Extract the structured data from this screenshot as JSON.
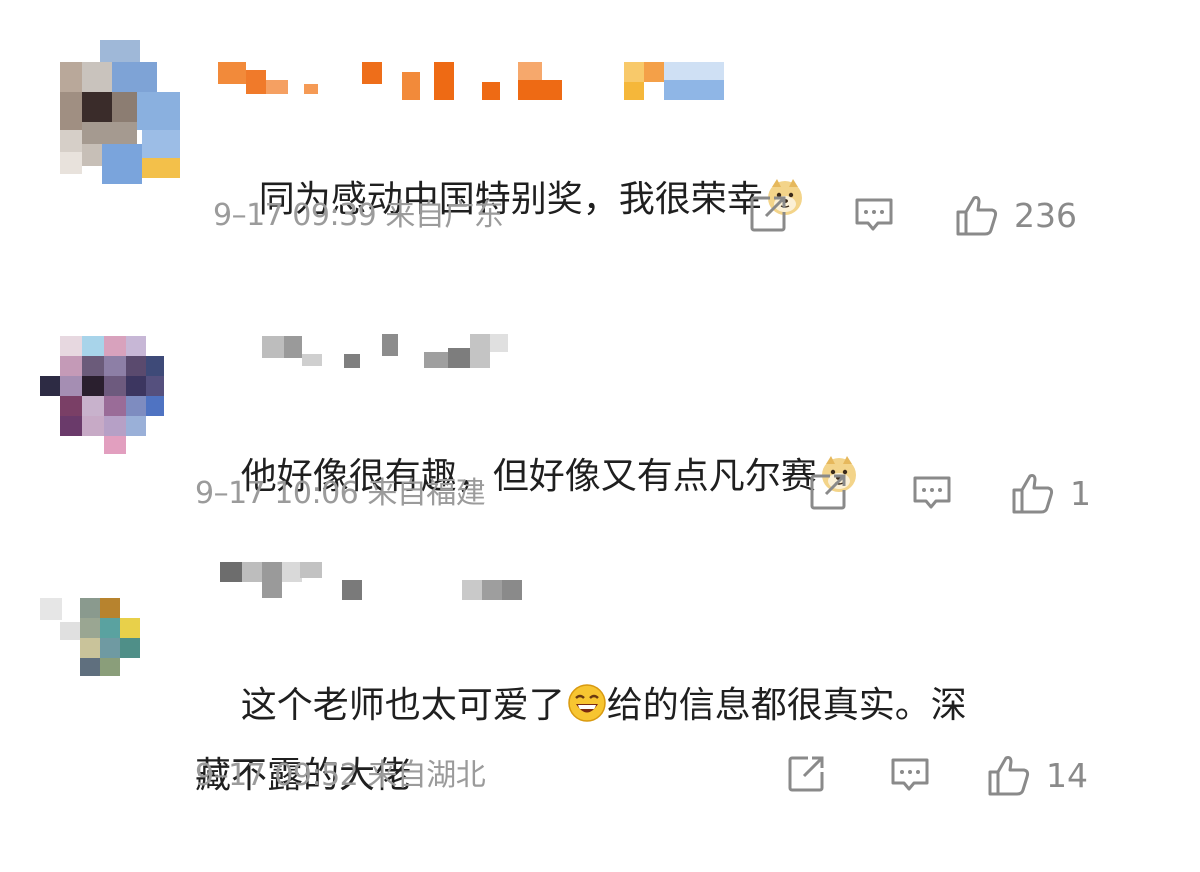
{
  "comments": [
    {
      "text": "同为感动中国特别奖，我很荣幸",
      "emoji": "doge-emoji",
      "time": "9–17 09:39",
      "location": "来自广东",
      "likes": "236"
    },
    {
      "text": "他好像很有趣，但好像又有点凡尔赛",
      "emoji": "doge-emoji",
      "time": "9–17 10:06",
      "location": "来自福建",
      "likes": "1"
    },
    {
      "text_part1": "这个老师也太可爱了",
      "emoji": "laughing-emoji",
      "text_part2": "给的信息都很真实。深",
      "text_line2": "藏不露的大佬",
      "time": "9–17 09:52",
      "location": "来自湖北",
      "likes": "14"
    }
  ],
  "icons": {
    "share": "share-icon",
    "comment": "comment-icon",
    "like": "thumbs-up-icon"
  },
  "colors": {
    "text": "#1f1f1f",
    "meta": "#9b9b9b",
    "icon": "#8a8a8a"
  }
}
